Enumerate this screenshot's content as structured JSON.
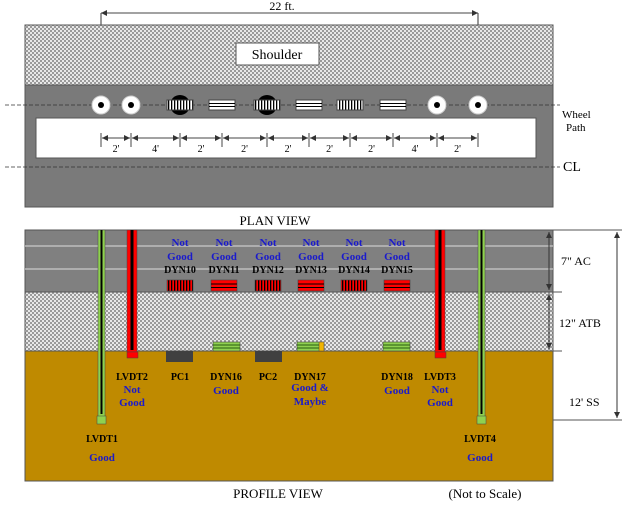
{
  "plan_view": {
    "title": "PLAN VIEW",
    "overall_dimension": "22 ft.",
    "shoulder_label": "Shoulder",
    "wheel_path_label_line1": "Wheel",
    "wheel_path_label_line2": "Path",
    "centerline_label": "CL",
    "spacings": [
      "2'",
      "4'",
      "2'",
      "2'",
      "2'",
      "2'",
      "2'",
      "4'",
      "2'"
    ],
    "sensors": [
      {
        "type": "lvdt",
        "name": "LVDT1"
      },
      {
        "type": "lvdt",
        "name": "LVDT2"
      },
      {
        "type": "pressure-cell",
        "name": "PC1"
      },
      {
        "type": "strain-gauge",
        "name": "DYN"
      },
      {
        "type": "pressure-cell",
        "name": "PC2"
      },
      {
        "type": "strain-gauge",
        "name": "DYN"
      },
      {
        "type": "strain-gauge-transverse",
        "name": "DYN"
      },
      {
        "type": "strain-gauge",
        "name": "DYN"
      },
      {
        "type": "lvdt",
        "name": "LVDT3"
      },
      {
        "type": "lvdt",
        "name": "LVDT4"
      }
    ]
  },
  "profile_view": {
    "title": "PROFILE VIEW",
    "note": "(Not to Scale)",
    "layers": [
      {
        "label": "7\" AC",
        "color": "#808080"
      },
      {
        "label": "12\" ATB",
        "color": "#c8c8c8"
      },
      {
        "label": "12' SS",
        "color": "#bf8a00"
      }
    ],
    "top_gauges": [
      {
        "name": "DYN10",
        "status_line1": "Not",
        "status_line2": "Good",
        "orientation": "vertical"
      },
      {
        "name": "DYN11",
        "status_line1": "Not",
        "status_line2": "Good",
        "orientation": "horizontal"
      },
      {
        "name": "DYN12",
        "status_line1": "Not",
        "status_line2": "Good",
        "orientation": "vertical"
      },
      {
        "name": "DYN13",
        "status_line1": "Not",
        "status_line2": "Good",
        "orientation": "horizontal"
      },
      {
        "name": "DYN14",
        "status_line1": "Not",
        "status_line2": "Good",
        "orientation": "vertical"
      },
      {
        "name": "DYN15",
        "status_line1": "Not",
        "status_line2": "Good",
        "orientation": "horizontal"
      }
    ],
    "bottom_sensors": [
      {
        "name": "LVDT2",
        "status_line1": "Not",
        "status_line2": "Good"
      },
      {
        "name": "PC1",
        "status_line1": "",
        "status_line2": ""
      },
      {
        "name": "DYN16",
        "status_line1": "Good",
        "status_line2": ""
      },
      {
        "name": "PC2",
        "status_line1": "",
        "status_line2": ""
      },
      {
        "name": "DYN17",
        "status_line1": "Good &",
        "status_line2": "Maybe"
      },
      {
        "name": "DYN18",
        "status_line1": "Good",
        "status_line2": ""
      },
      {
        "name": "LVDT3",
        "status_line1": "Not",
        "status_line2": "Good"
      }
    ],
    "deep_sensors": [
      {
        "name": "LVDT1",
        "status": "Good"
      },
      {
        "name": "LVDT4",
        "status": "Good"
      }
    ],
    "colors": {
      "not_good": "#ff0000",
      "good": "#8fd14f",
      "maybe": "#f0b400",
      "status_text": "#1a1acc"
    }
  }
}
